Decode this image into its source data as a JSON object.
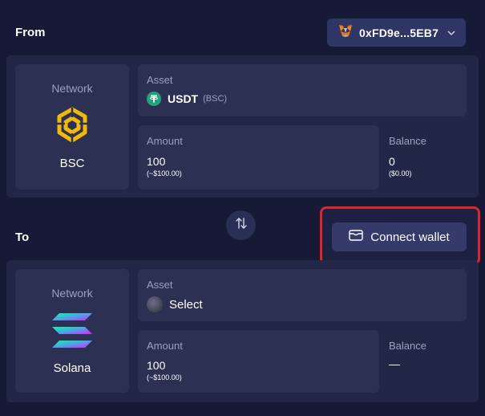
{
  "from": {
    "label": "From",
    "wallet_address": "0xFD9e...5EB7",
    "network": {
      "label": "Network",
      "name": "BSC",
      "icon": "bnb-icon"
    },
    "asset": {
      "label": "Asset",
      "symbol": "USDT",
      "chain_tag": "(BSC)",
      "icon": "tether-icon"
    },
    "amount": {
      "label": "Amount",
      "value": "100",
      "usd": "(~$100.00)"
    },
    "balance": {
      "label": "Balance",
      "value": "0",
      "usd": "($0.00)"
    }
  },
  "swap": {
    "icon": "swap-arrows-icon"
  },
  "to": {
    "label": "To",
    "connect_label": "Connect wallet",
    "network": {
      "label": "Network",
      "name": "Solana",
      "icon": "solana-icon"
    },
    "asset": {
      "label": "Asset",
      "value": "Select"
    },
    "amount": {
      "label": "Amount",
      "value": "100",
      "usd": "(~$100.00)"
    },
    "balance": {
      "label": "Balance",
      "value": "—"
    }
  },
  "colors": {
    "background": "#161a36",
    "card": "#232747",
    "card_inner": "#2c3154",
    "highlight": "#d9262b",
    "bnb": "#f0b90b",
    "tether": "#26a17b"
  }
}
